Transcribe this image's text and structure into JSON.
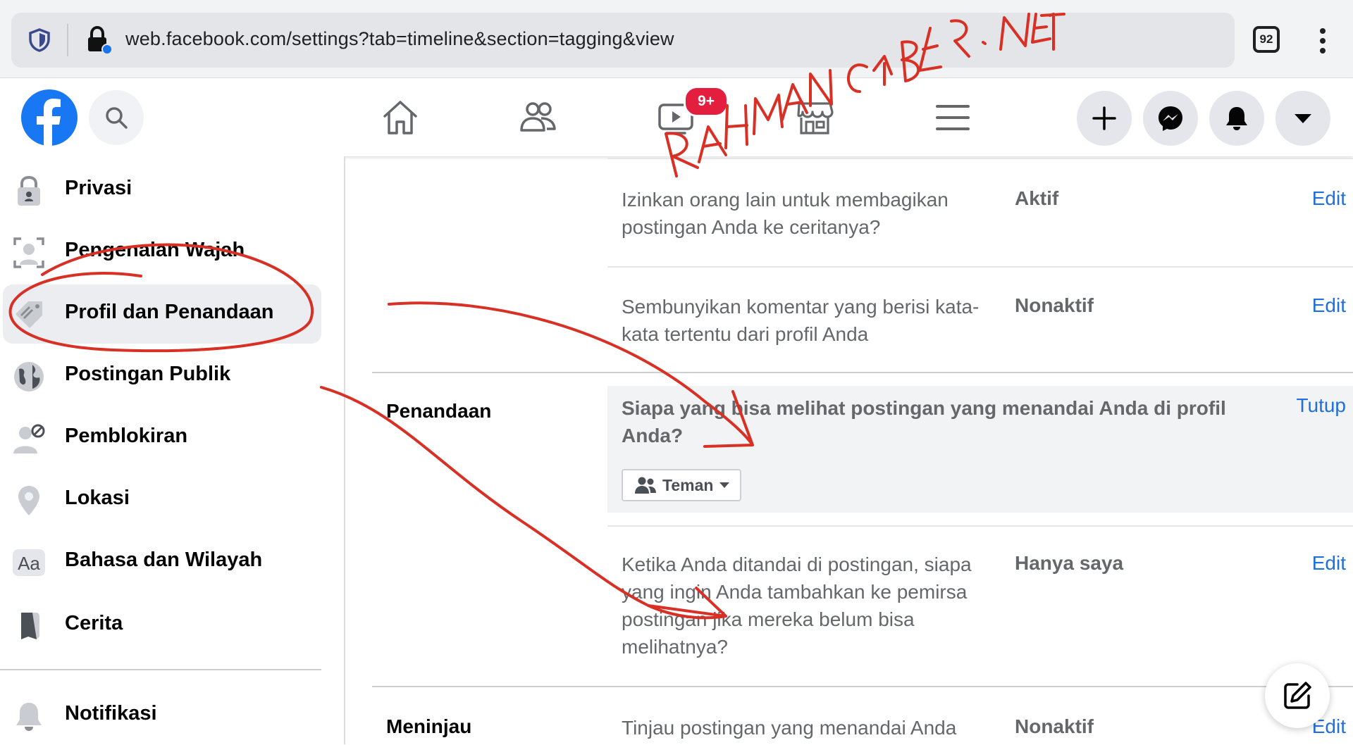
{
  "browser": {
    "url": "web.facebook.com/settings?tab=timeline&section=tagging&view",
    "tab_count": "92"
  },
  "header": {
    "watch_badge": "9+",
    "icons": [
      "facebook-logo",
      "search-icon",
      "home-icon",
      "friends-icon",
      "watch-icon",
      "marketplace-icon",
      "menu-icon",
      "plus-icon",
      "messenger-icon",
      "bell-icon",
      "caret-down-icon"
    ]
  },
  "sidebar": {
    "items": [
      {
        "label": "Privasi",
        "icon": "lock-icon"
      },
      {
        "label": "Pengenalan Wajah",
        "icon": "face-recognition-icon"
      },
      {
        "label": "Profil dan Penandaan",
        "icon": "tag-icon",
        "active": true
      },
      {
        "label": "Postingan Publik",
        "icon": "globe-icon"
      },
      {
        "label": "Pemblokiran",
        "icon": "blocked-user-icon"
      },
      {
        "label": "Lokasi",
        "icon": "location-pin-icon"
      },
      {
        "label": "Bahasa dan Wilayah",
        "icon": "language-icon"
      },
      {
        "label": "Cerita",
        "icon": "story-icon"
      },
      {
        "label": "Notifikasi",
        "icon": "bell-icon"
      }
    ]
  },
  "settings": {
    "row1": {
      "question": "Izinkan orang lain untuk membagikan postingan Anda ke ceritanya?",
      "status": "Aktif",
      "action": "Edit"
    },
    "row2": {
      "question": "Sembunyikan komentar yang berisi kata-kata tertentu dari profil Anda",
      "status": "Nonaktif",
      "action": "Edit"
    },
    "tagging": {
      "section_title": "Penandaan",
      "expanded_question": "Siapa yang bisa melihat postingan yang menandai Anda di profil Anda?",
      "close_label": "Tutup",
      "audience_value": "Teman"
    },
    "row3": {
      "question": "Ketika Anda ditandai di postingan, siapa yang ingin Anda tambahkan ke pemirsa postingan jika mereka belum bisa melihatnya?",
      "status": "Hanya saya",
      "action": "Edit"
    },
    "review": {
      "section_title": "Meninjau",
      "question": "Tinjau postingan yang menandai Anda",
      "status": "Nonaktif",
      "action": "Edit"
    }
  },
  "watermark": "RAHMANCYBER .NET",
  "colors": {
    "facebook_blue": "#1877f2",
    "link_blue": "#216fdb",
    "badge_red": "#e41e3f",
    "annotation_red": "#d93025"
  }
}
